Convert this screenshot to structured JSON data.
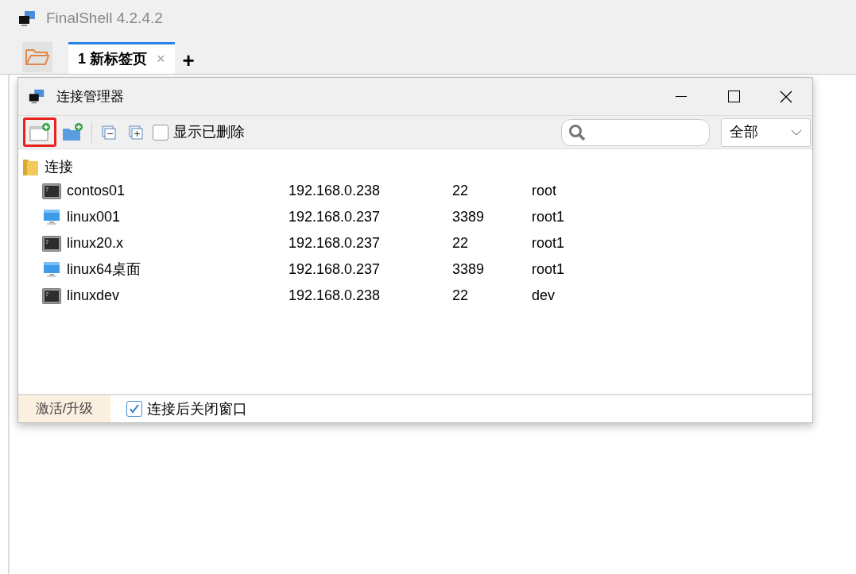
{
  "window": {
    "title": "FinalShell 4.2.4.2"
  },
  "tabs": [
    {
      "label": "1 新标签页",
      "selected": true,
      "close": "×"
    }
  ],
  "add_tab": "+",
  "dialog": {
    "title": "连接管理器",
    "show_deleted": {
      "label": "显示已删除",
      "checked": false
    },
    "filter": {
      "value": "全部"
    },
    "new_connection_highlighted": true,
    "tree": {
      "label": "连接",
      "children": [
        {
          "kind": "ssh",
          "name": "contos01",
          "host": "192.168.0.238",
          "port": "22",
          "user": "root"
        },
        {
          "kind": "desktop",
          "name": "linux001",
          "host": "192.168.0.237",
          "port": "3389",
          "user": "root1"
        },
        {
          "kind": "ssh",
          "name": "linux20.x",
          "host": "192.168.0.237",
          "port": "22",
          "user": "root1"
        },
        {
          "kind": "desktop",
          "name": "linux64桌面",
          "host": "192.168.0.237",
          "port": "3389",
          "user": "root1"
        },
        {
          "kind": "ssh",
          "name": "linuxdev",
          "host": "192.168.0.238",
          "port": "22",
          "user": "dev"
        }
      ]
    },
    "activate_button": "激活/升级",
    "close_after_connect": {
      "label": "连接后关闭窗口",
      "checked": true
    }
  }
}
